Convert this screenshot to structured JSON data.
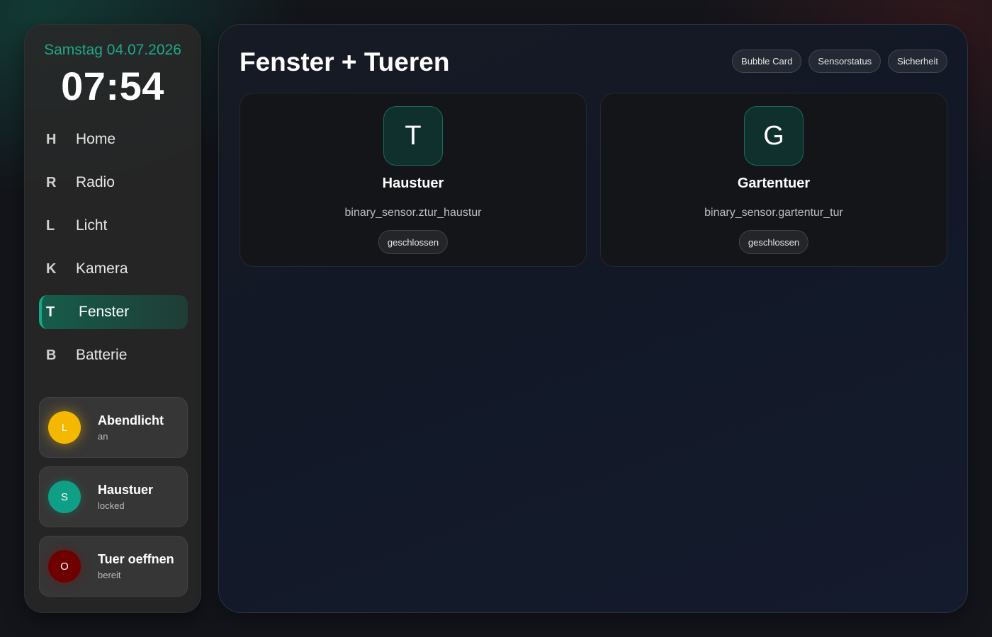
{
  "sidebar": {
    "date": "Samstag 04.07.2026",
    "time": "07:54",
    "nav": [
      {
        "letter": "H",
        "label": "Home"
      },
      {
        "letter": "R",
        "label": "Radio"
      },
      {
        "letter": "L",
        "label": "Licht"
      },
      {
        "letter": "K",
        "label": "Kamera"
      },
      {
        "letter": "T",
        "label": "Fenster",
        "active": true
      },
      {
        "letter": "B",
        "label": "Batterie"
      }
    ],
    "tiles": [
      {
        "letter": "L",
        "title": "Abendlicht",
        "status": "an",
        "color": "#f5b800"
      },
      {
        "letter": "S",
        "title": "Haustuer",
        "status": "locked",
        "color": "#0f9f86"
      },
      {
        "letter": "O",
        "title": "Tuer oeffnen",
        "status": "bereit",
        "color": "#6e0000"
      }
    ]
  },
  "main": {
    "title": "Fenster + Tueren",
    "chips": [
      "Bubble Card",
      "Sensorstatus",
      "Sicherheit"
    ],
    "cards": [
      {
        "letter": "T",
        "name": "Haustuer",
        "entity": "binary_sensor.ztur_haustur",
        "state": "geschlossen"
      },
      {
        "letter": "G",
        "name": "Gartentuer",
        "entity": "binary_sensor.gartentur_tur",
        "state": "geschlossen"
      }
    ]
  },
  "colors": {
    "accent": "#1fa98a",
    "active_nav": "#15a889",
    "icon_box": "#10302d"
  }
}
